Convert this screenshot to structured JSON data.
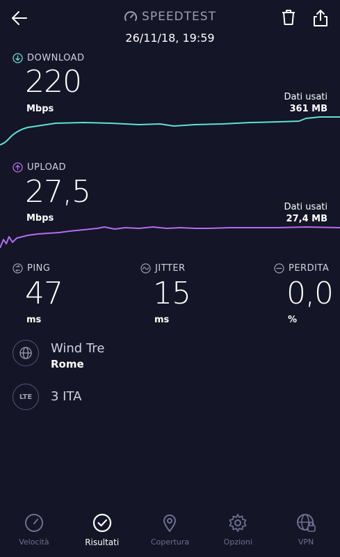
{
  "header": {
    "title": "SPEEDTEST",
    "date": "26/11/18, 19:59"
  },
  "download": {
    "label": "DOWNLOAD",
    "value": "220",
    "unit": "Mbps",
    "used_label": "Dati usati",
    "used_value": "361 MB",
    "color": "#5fe3d6"
  },
  "upload": {
    "label": "UPLOAD",
    "value": "27,5",
    "unit": "Mbps",
    "used_label": "Dati usati",
    "used_value": "27,4 MB",
    "color": "#b46ef0"
  },
  "stats": {
    "ping": {
      "label": "PING",
      "value": "47",
      "unit": "ms"
    },
    "jitter": {
      "label": "JITTER",
      "value": "15",
      "unit": "ms"
    },
    "loss": {
      "label": "PERDITA",
      "value": "0,0",
      "unit": "%"
    }
  },
  "network": {
    "provider": "Wind Tre",
    "city": "Rome",
    "badge": "LTE",
    "carrier": "3 ITA"
  },
  "nav": [
    {
      "label": "Velocità",
      "icon": "speedometer-icon"
    },
    {
      "label": "Risultati",
      "icon": "check-circle-icon"
    },
    {
      "label": "Copertura",
      "icon": "map-pin-icon"
    },
    {
      "label": "Opzioni",
      "icon": "gear-icon"
    },
    {
      "label": "VPN",
      "icon": "globe-lock-icon"
    }
  ]
}
